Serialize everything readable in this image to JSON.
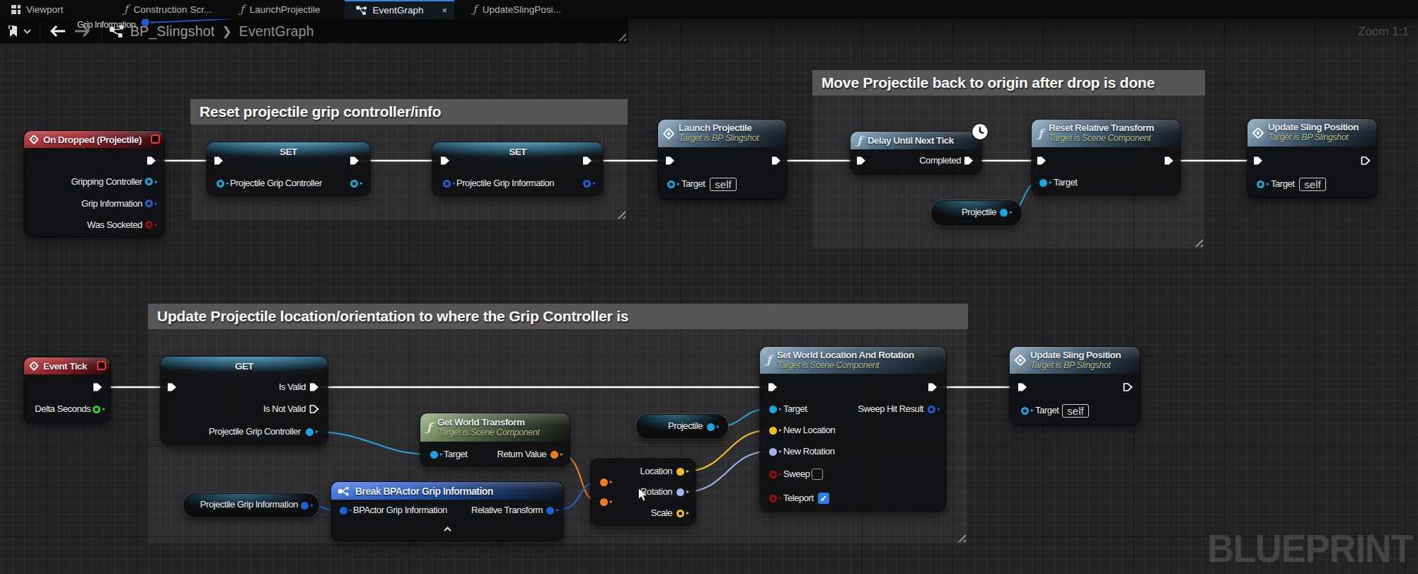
{
  "tab_bar": {
    "tabs": [
      {
        "label": "Viewport",
        "icon": "viewport-grid"
      },
      {
        "label": "Construction Scr...",
        "icon": "function"
      },
      {
        "label": "LaunchProjectile",
        "icon": "function"
      },
      {
        "label": "EventGraph",
        "icon": "event-graph",
        "active": true,
        "close_label": "×"
      },
      {
        "label": "UpdateSlingPosi...",
        "icon": "function"
      }
    ]
  },
  "toolbar": {
    "breadcrumb_root": "BP_Slingshot",
    "breadcrumb_sep": "❯",
    "breadcrumb_current": "EventGraph"
  },
  "zoom_label": "Zoom 1:1",
  "watermark": "BLUEPRINT",
  "floating_pin": {
    "label": "Grip Information"
  },
  "comments": [
    {
      "title": "Reset projectile grip controller/info"
    },
    {
      "title": "Move Projectile back to origin after drop is done"
    },
    {
      "title": "Update Projectile location/orientation to where the Grip Controller is"
    }
  ],
  "nodes": {
    "on_dropped": {
      "title": "On Dropped (Projectile)",
      "pin_gripping": "Gripping Controller",
      "pin_gripinfo": "Grip Information",
      "pin_socketed": "Was Socketed"
    },
    "set_grip_controller": {
      "title": "SET",
      "pin": "Projectile Grip Controller"
    },
    "set_grip_information": {
      "title": "SET",
      "pin": "Projectile Grip Information"
    },
    "launch_projectile": {
      "title": "Launch Projectile",
      "subtitle": "Target is BP Slingshot",
      "pin_target": "Target",
      "self_value": "self"
    },
    "delay_until_next_tick": {
      "title": "Delay Until Next Tick",
      "pin_completed": "Completed"
    },
    "reset_relative_transform": {
      "title": "Reset Relative Transform",
      "subtitle": "Target is Scene Component",
      "pin_target": "Target"
    },
    "projectile_var_top": {
      "label": "Projectile"
    },
    "update_sling_top": {
      "title": "Update Sling Position",
      "subtitle": "Target is BP Slingshot",
      "pin_target": "Target",
      "self_value": "self"
    },
    "event_tick": {
      "title": "Event Tick",
      "pin_delta": "Delta Seconds"
    },
    "get_node": {
      "title": "GET",
      "pin_isvalid": "Is Valid",
      "pin_isnotvalid": "Is Not Valid",
      "pin_out": "Projectile Grip Controller"
    },
    "get_world_transform": {
      "title": "Get World Transform",
      "subtitle": "Target is Scene Component",
      "pin_target": "Target",
      "pin_return": "Return Value"
    },
    "pgi_var": {
      "label": "Projectile Grip Information"
    },
    "break_grip_info": {
      "title": "Break BPActor Grip Information",
      "pin_in": "BPActor Grip Information",
      "pin_out": "Relative Transform"
    },
    "break_transform": {
      "pin_location": "Location",
      "pin_rotation": "Rotation",
      "pin_scale": "Scale"
    },
    "projectile_var_bottom": {
      "label": "Projectile"
    },
    "set_world_loc_rot": {
      "title": "Set World Location And Rotation",
      "subtitle": "Target is Scene Component",
      "pin_target": "Target",
      "pin_newloc": "New Location",
      "pin_newrot": "New Rotation",
      "pin_sweep": "Sweep",
      "pin_teleport": "Teleport",
      "teleport_checked": "✓",
      "pin_sweephit": "Sweep Hit Result"
    },
    "update_sling_bottom": {
      "title": "Update Sling Position",
      "subtitle": "Target is BP Slingshot",
      "pin_target": "Target",
      "self_value": "self"
    }
  },
  "colors": {
    "exec_wire": "#ffffff",
    "object_pin": "#1aa4e0",
    "struct_pin": "#1e5fd2",
    "float_pin": "#35cf35",
    "transform_pin": "#ef7c1d",
    "vector_pin": "#f2c021",
    "rotator_pin": "#a4b1ed",
    "bool_pin": "#9c0f0f",
    "active_tab_accent": "#2f87e0"
  }
}
